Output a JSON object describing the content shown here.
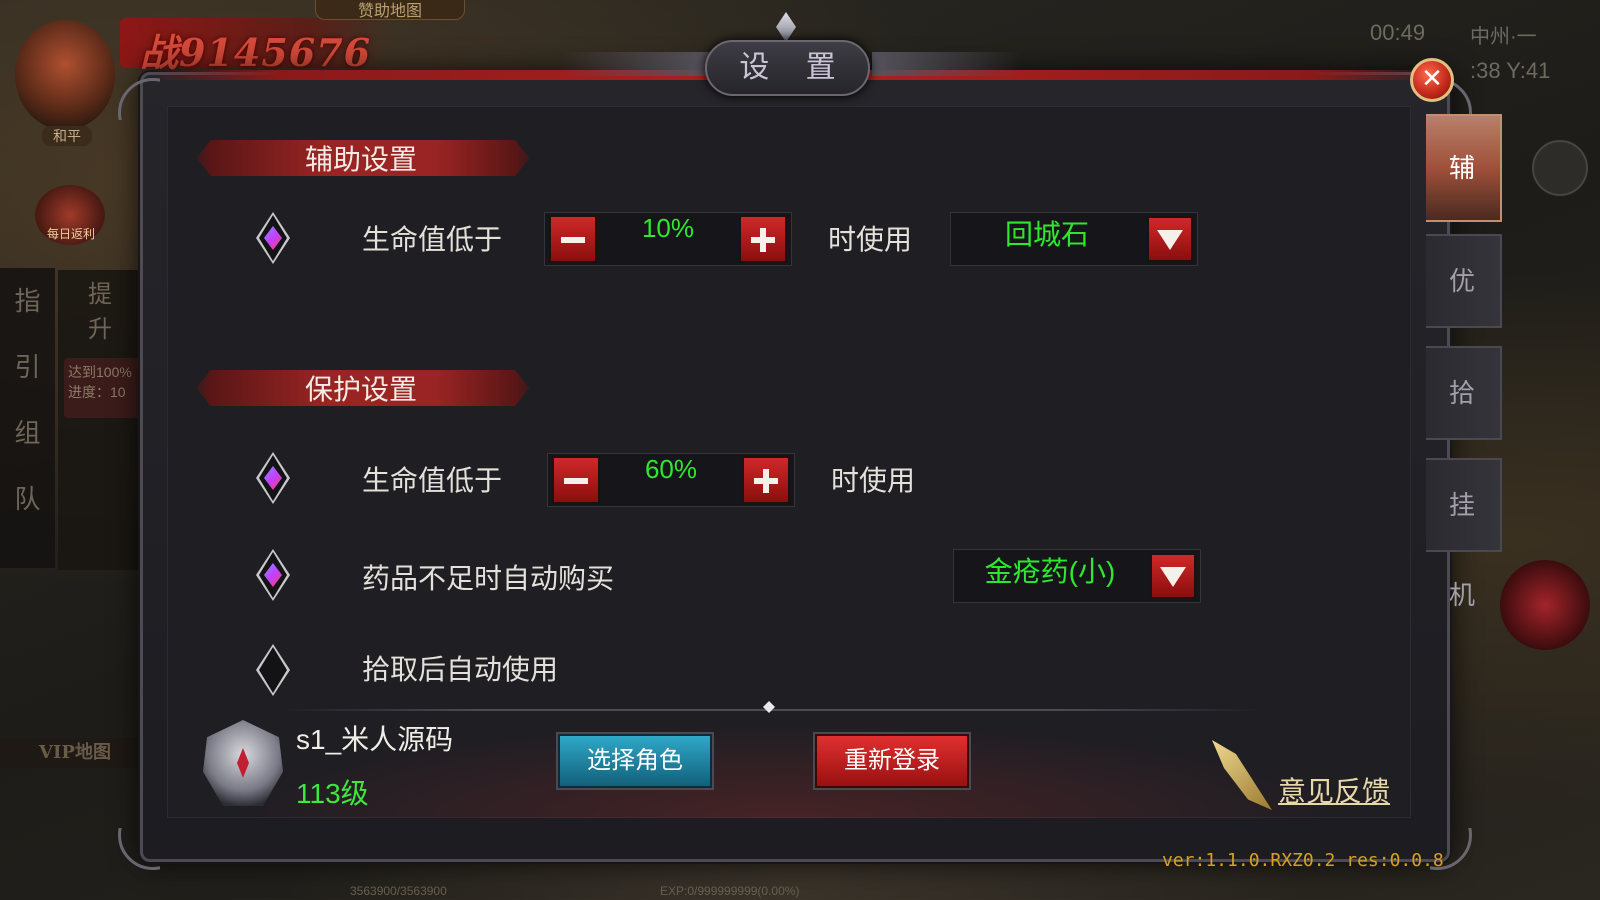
{
  "background": {
    "power_value": "战9145676",
    "map_label": "赞助地图",
    "peace_label": "和平",
    "gift_label": "每日返利",
    "left_nav": [
      "指",
      "引",
      "组",
      "队"
    ],
    "task_tab": "提 升",
    "task_line1": "达到100%",
    "task_line2": "进度：10",
    "vip_map": "VIP地图",
    "clock": "00:49",
    "location": "中州·一",
    "coords": ":38  Y:41",
    "exp_text": "EXP:0/999999999(0.00%)",
    "hp_text": "3563900/3563900"
  },
  "dialog": {
    "title": "设 置",
    "close_icon": "close-icon"
  },
  "assist": {
    "header": "辅助设置",
    "row_label": "生命值低于",
    "percent": "10%",
    "suffix": "时使用",
    "item": "回城石"
  },
  "protect": {
    "header": "保护设置",
    "row1_label": "生命值低于",
    "row1_percent": "60%",
    "row1_suffix": "时使用",
    "row2_label": "药品不足时自动购买",
    "row2_item": "金疮药(小)",
    "row3_label": "拾取后自动使用"
  },
  "player": {
    "name": "s1_米人源码",
    "level": "113级"
  },
  "buttons": {
    "select_role": "选择角色",
    "relogin": "重新登录",
    "feedback": "意见反馈"
  },
  "tabs": [
    {
      "label": "辅助",
      "active": true
    },
    {
      "label": "优化",
      "active": false
    },
    {
      "label": "拾取",
      "active": false
    },
    {
      "label": "挂机",
      "active": false
    }
  ],
  "version": "ver:1.1.0.RXZ0.2 res:0.0.8",
  "colors": {
    "accent_green": "#2ee82e",
    "accent_red": "#c02020",
    "button_blue": "#1d87a6"
  }
}
